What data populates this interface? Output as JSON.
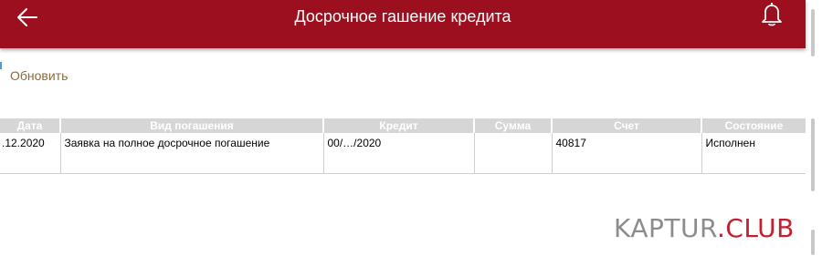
{
  "header": {
    "title": "Досрочное гашение кредита",
    "back_icon": "arrow-left-icon",
    "bell_icon": "bell-icon",
    "background_color": "#9b0f1f"
  },
  "toolbar": {
    "refresh_label": "Обновить"
  },
  "table": {
    "columns": [
      "Дата",
      "Вид погашения",
      "Кредит",
      "Сумма",
      "Счет",
      "Состояние"
    ],
    "rows": [
      {
        "date": ".12.2020",
        "type": "Заявка на полное досрочное погашение",
        "credit": "00/…/2020",
        "amount": "",
        "account": "40817",
        "status": "Исполнен"
      }
    ]
  },
  "watermark": {
    "part1": "KAPTUR",
    "part2": ".",
    "part3": "CLUB"
  }
}
